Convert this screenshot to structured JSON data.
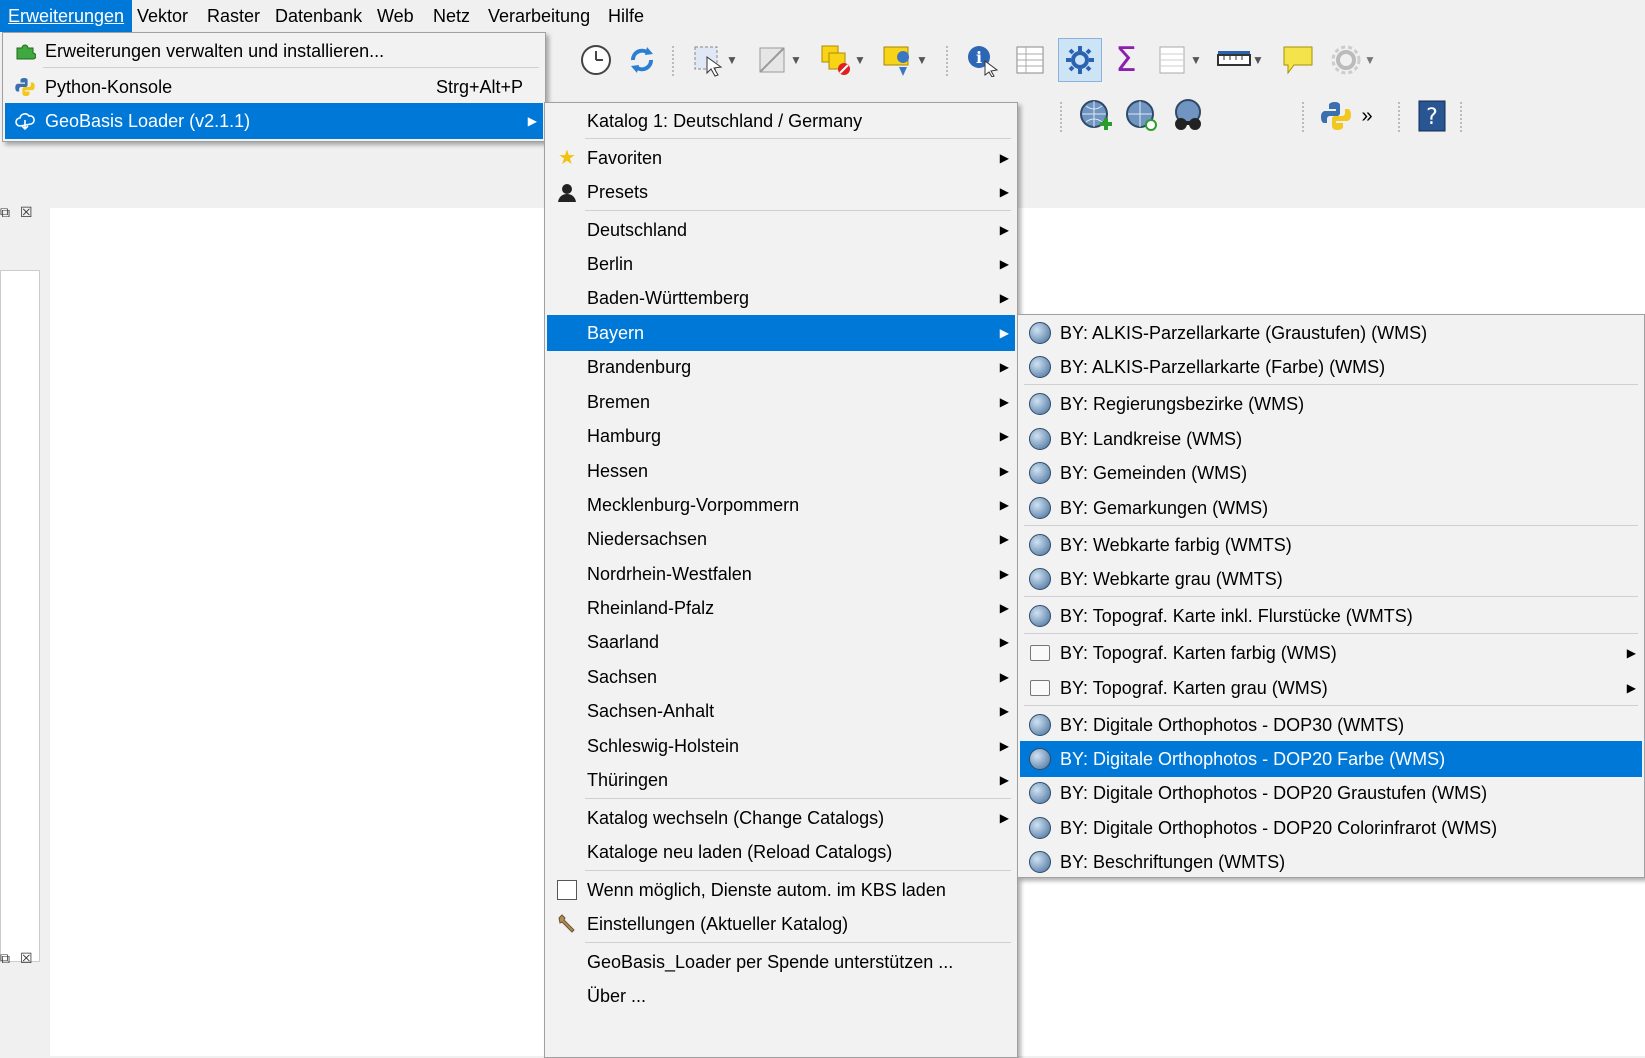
{
  "menubar": {
    "items": [
      {
        "label": "Erweiterungen"
      },
      {
        "label": "Vektor"
      },
      {
        "label": "Raster"
      },
      {
        "label": "Datenbank"
      },
      {
        "label": "Web"
      },
      {
        "label": "Netz"
      },
      {
        "label": "Verarbeitung"
      },
      {
        "label": "Hilfe"
      }
    ]
  },
  "plugins_menu": {
    "items": [
      {
        "label": "Erweiterungen verwalten und installieren...",
        "icon": "puzzle-icon"
      },
      {
        "label": "Python-Konsole",
        "shortcut": "Strg+Alt+P",
        "icon": "python-icon"
      },
      {
        "label": "GeoBasis Loader (v2.1.1)",
        "icon": "cloud-icon"
      }
    ]
  },
  "geobasis_menu": {
    "catalog_title": "Katalog 1: Deutschland / Germany",
    "items": [
      {
        "label": "Favoriten",
        "icon": "star-icon"
      },
      {
        "label": "Presets",
        "icon": "person-icon"
      },
      {
        "label": "Deutschland"
      },
      {
        "label": "Berlin"
      },
      {
        "label": "Baden-Württemberg"
      },
      {
        "label": "Bayern"
      },
      {
        "label": "Brandenburg"
      },
      {
        "label": "Bremen"
      },
      {
        "label": "Hamburg"
      },
      {
        "label": "Hessen"
      },
      {
        "label": "Mecklenburg-Vorpommern"
      },
      {
        "label": "Niedersachsen"
      },
      {
        "label": "Nordrhein-Westfalen"
      },
      {
        "label": "Rheinland-Pfalz"
      },
      {
        "label": "Saarland"
      },
      {
        "label": "Sachsen"
      },
      {
        "label": "Sachsen-Anhalt"
      },
      {
        "label": "Schleswig-Holstein"
      },
      {
        "label": "Thüringen"
      }
    ],
    "change_catalog": "Katalog wechseln (Change Catalogs)",
    "reload_catalogs": "Kataloge neu laden (Reload Catalogs)",
    "auto_crs": "Wenn möglich, Dienste autom. im KBS laden",
    "settings": "Einstellungen (Aktueller Katalog)",
    "donate": "GeoBasis_Loader per Spende unterstützen ...",
    "about": "Über ..."
  },
  "bayern_menu": {
    "items": [
      {
        "label": "BY: ALKIS-Parzellarkarte (Graustufen) (WMS)",
        "icon": "globe-icon"
      },
      {
        "label": "BY: ALKIS-Parzellarkarte (Farbe) (WMS)",
        "icon": "globe-icon"
      },
      {
        "label": "BY: Regierungsbezirke (WMS)",
        "icon": "globe-icon"
      },
      {
        "label": "BY: Landkreise (WMS)",
        "icon": "globe-icon"
      },
      {
        "label": "BY: Gemeinden (WMS)",
        "icon": "globe-icon"
      },
      {
        "label": "BY: Gemarkungen (WMS)",
        "icon": "globe-icon"
      },
      {
        "label": "BY: Webkarte farbig (WMTS)",
        "icon": "globe-icon"
      },
      {
        "label": "BY: Webkarte grau (WMTS)",
        "icon": "globe-icon"
      },
      {
        "label": "BY: Topograf. Karte  inkl. Flurstücke (WMTS)",
        "icon": "globe-icon"
      },
      {
        "label": "BY: Topograf. Karten farbig (WMS)",
        "icon": "folder-icon"
      },
      {
        "label": "BY: Topograf. Karten grau (WMS)",
        "icon": "folder-icon"
      },
      {
        "label": "BY: Digitale Orthophotos - DOP30 (WMTS)",
        "icon": "globe-icon"
      },
      {
        "label": "BY: Digitale Orthophotos - DOP20 Farbe (WMS)",
        "icon": "globe-icon"
      },
      {
        "label": "BY: Digitale Orthophotos - DOP20 Graustufen (WMS)",
        "icon": "globe-icon"
      },
      {
        "label": "BY: Digitale Orthophotos - DOP20 Colorinfrarot (WMS)",
        "icon": "globe-icon"
      },
      {
        "label": "BY: Beschriftungen (WMTS)",
        "icon": "globe-icon"
      }
    ]
  },
  "toolbar": {
    "overflow_label": "»",
    "icons": [
      "clock-icon",
      "refresh-icon",
      "select-icon",
      "deselect-icon",
      "layer-style-icon",
      "annotation-icon",
      "identify-icon",
      "attribute-table-icon",
      "settings-icon",
      "statistics-icon",
      "field-calc-icon",
      "measure-icon",
      "tooltip-icon",
      "render-settings-icon",
      "add-wms-icon",
      "wms-search-icon",
      "geobasis-icon",
      "python-icon",
      "help-icon"
    ]
  },
  "colors": {
    "accent": "#0078d7"
  }
}
